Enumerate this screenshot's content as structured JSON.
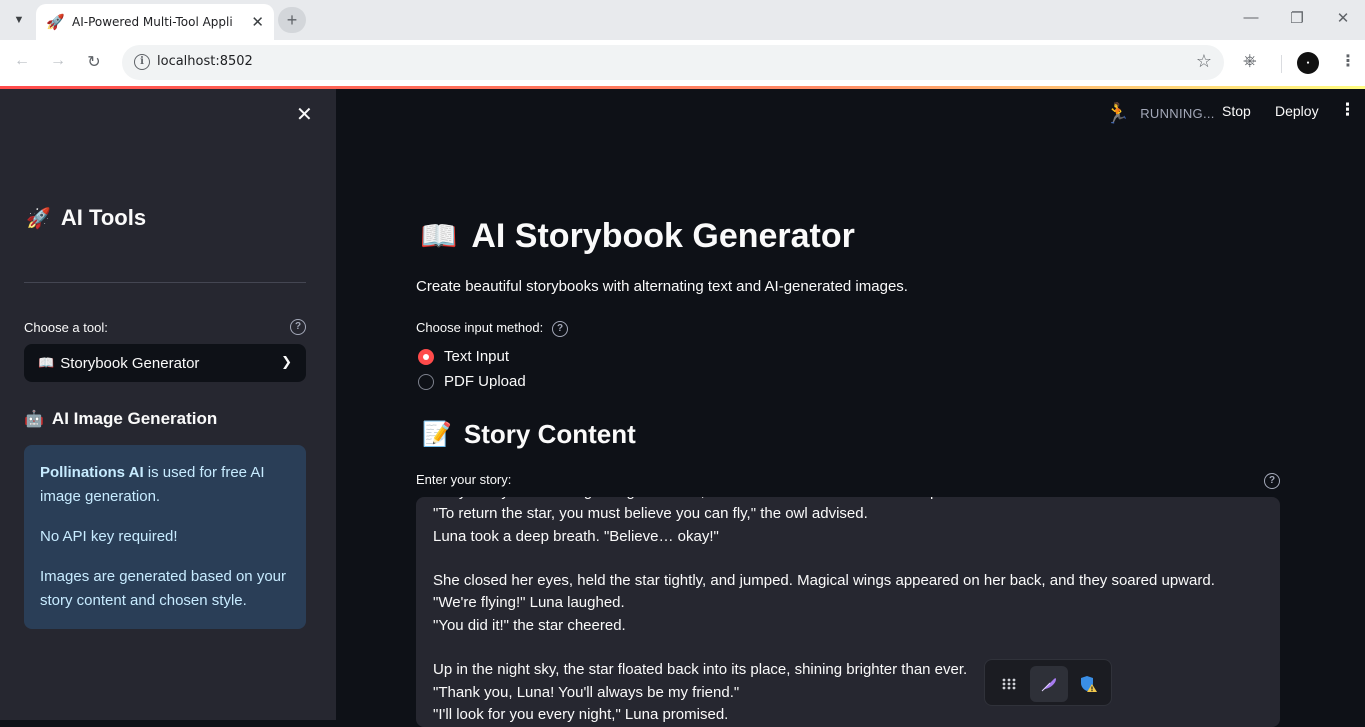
{
  "browser": {
    "tab_title": "AI-Powered Multi-Tool Applicat",
    "url": "localhost:8502"
  },
  "header": {
    "status": "RUNNING...",
    "stop_label": "Stop",
    "deploy_label": "Deploy"
  },
  "sidebar": {
    "title": "AI Tools",
    "tool_label": "Choose a tool:",
    "selected_tool": "Storybook Generator",
    "section_title": "AI Image Generation",
    "info": {
      "brand": "Pollinations AI",
      "line1_rest": " is used for free AI image generation.",
      "line2": "No API key required!",
      "line3": "Images are generated based on your story content and chosen style."
    }
  },
  "main": {
    "title": "AI Storybook Generator",
    "description": "Create beautiful storybooks with alternating text and AI-generated images.",
    "input_method_label": "Choose input method:",
    "options": [
      "Text Input",
      "PDF Upload"
    ],
    "selected_option": "Text Input",
    "section_title": "Story Content",
    "story_label": "Enter your story:",
    "story_text": "They finally reached a glowing mountain, where a wise old owl sat at the top.\n\"To return the star, you must believe you can fly,\" the owl advised.\nLuna took a deep breath. \"Believe… okay!\"\n\nShe closed her eyes, held the star tightly, and jumped. Magical wings appeared on her back, and they soared upward.\n\"We're flying!\" Luna laughed.\n\"You did it!\" the star cheered.\n\nUp in the night sky, the star floated back into its place, shining brighter than ever.\n\"Thank you, Luna! You'll always be my friend.\"\n\"I'll look for you every night,\" Luna promised."
  },
  "colors": {
    "accent": "#ff4b4b",
    "sidebar_bg": "#262730",
    "main_bg": "#0e1117",
    "info_text": "#c7ebff"
  }
}
